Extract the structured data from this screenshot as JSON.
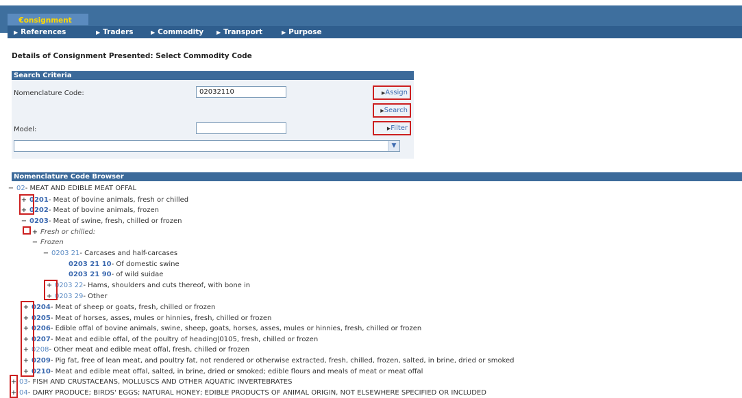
{
  "nav": {
    "active_tab": "Consignment",
    "items": [
      "References",
      "Traders",
      "Commodity",
      "Transport",
      "Purpose"
    ]
  },
  "page_title": "Details of Consignment Presented: Select Commodity Code",
  "search": {
    "header": "Search Criteria",
    "nomenclature_label": "Nomenclature Code:",
    "nomenclature_value": "02032110",
    "model_label": "Model:",
    "model_value": "",
    "assign_label": "Assign",
    "search_label": "Search",
    "filter_label": "Filter",
    "select_value": ""
  },
  "browser": {
    "header": "Nomenclature Code Browser",
    "rows": [
      {
        "toggle": "−",
        "code": "02",
        "text": "- MEAT AND EDIBLE MEAT OFFAL"
      },
      {
        "toggle": "+",
        "code": "0201",
        "text": "- Meat of bovine animals, fresh or chilled"
      },
      {
        "toggle": "+",
        "code": "0202",
        "text": "- Meat of bovine animals, frozen"
      },
      {
        "toggle": "−",
        "code": "0203",
        "text": "- Meat of swine, fresh, chilled or frozen"
      },
      {
        "toggle": "+",
        "code": "",
        "text": "Fresh or chilled:"
      },
      {
        "toggle": "−",
        "code": "",
        "text": "Frozen"
      },
      {
        "toggle": "−",
        "code": "0203 21",
        "text": "- Carcases and half-carcases"
      },
      {
        "toggle": "",
        "code": "0203 21 10",
        "text": "- Of domestic swine"
      },
      {
        "toggle": "",
        "code": "0203 21 90",
        "text": "- of wild suidae"
      },
      {
        "toggle": "+",
        "code": "0203 22",
        "text": "- Hams, shoulders and cuts thereof, with bone in"
      },
      {
        "toggle": "+",
        "code": "0203 29",
        "text": "- Other"
      },
      {
        "toggle": "+",
        "code": "0204",
        "text": "- Meat of sheep or goats, fresh, chilled or frozen"
      },
      {
        "toggle": "+",
        "code": "0205",
        "text": "- Meat of horses, asses, mules or hinnies, fresh, chilled or frozen"
      },
      {
        "toggle": "+",
        "code": "0206",
        "text": "- Edible offal of bovine animals, swine, sheep, goats, horses, asses, mules or hinnies, fresh, chilled or frozen"
      },
      {
        "toggle": "+",
        "code": "0207",
        "text": "- Meat and edible offal, of the poultry of heading|0105, fresh, chilled or frozen"
      },
      {
        "toggle": "+",
        "code": "0208",
        "text": "- Other meat and edible meat offal, fresh, chilled or frozen"
      },
      {
        "toggle": "+",
        "code": "0209",
        "text": "- Pig fat, free of lean meat, and poultry fat, not rendered or otherwise extracted, fresh, chilled, frozen, salted, in brine, dried or smoked"
      },
      {
        "toggle": "+",
        "code": "0210",
        "text": "- Meat and edible meat offal, salted, in brine, dried or smoked; edible flours and meals of meat or meat offal"
      },
      {
        "toggle": "+",
        "code": "03",
        "text": "- FISH AND CRUSTACEANS, MOLLUSCS AND OTHER AQUATIC INVERTEBRATES"
      },
      {
        "toggle": "+",
        "code": "04",
        "text": "- DAIRY PRODUCE; BIRDS' EGGS; NATURAL HONEY; EDIBLE PRODUCTS OF ANIMAL ORIGIN, NOT ELSEWHERE SPECIFIED OR INCLUDED"
      }
    ]
  }
}
